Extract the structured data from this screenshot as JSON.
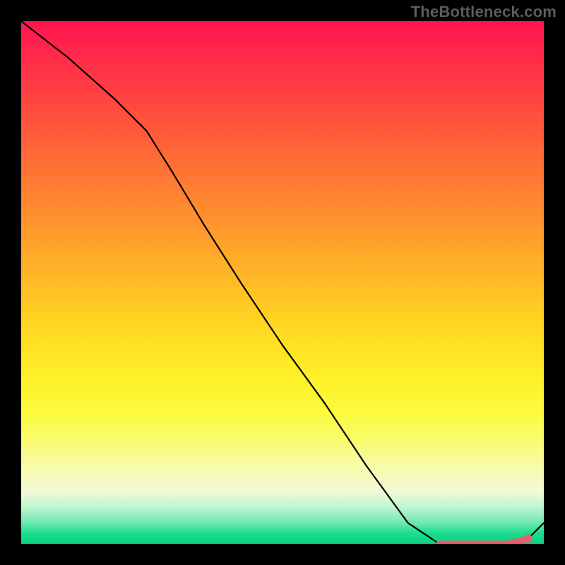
{
  "watermark": "TheBottleneck.com",
  "chart_data": {
    "type": "line",
    "title": "",
    "xlabel": "",
    "ylabel": "",
    "xlim": [
      0,
      100
    ],
    "ylim": [
      0,
      100
    ],
    "grid": false,
    "series": [
      {
        "name": "curve",
        "x": [
          0,
          9,
          18,
          24,
          29,
          35,
          42,
          50,
          58,
          66,
          74,
          80,
          84,
          88,
          93,
          97,
          100
        ],
        "values": [
          100,
          93,
          85,
          79,
          71,
          61,
          50,
          38,
          27,
          15,
          4,
          0,
          0,
          0,
          0,
          1,
          4
        ]
      }
    ],
    "highlight": {
      "x": [
        80,
        84,
        88,
        93,
        97
      ],
      "values": [
        0,
        0,
        0,
        0,
        1
      ],
      "end_marker": {
        "x": 97,
        "y": 1
      }
    },
    "gradient_stops": [
      {
        "pos": 0,
        "color": "#ff1551"
      },
      {
        "pos": 27,
        "color": "#ff6e36"
      },
      {
        "pos": 57,
        "color": "#ffd322"
      },
      {
        "pos": 80,
        "color": "#f9fb6b"
      },
      {
        "pos": 96,
        "color": "#6de9ae"
      },
      {
        "pos": 100,
        "color": "#0fd181"
      }
    ]
  }
}
